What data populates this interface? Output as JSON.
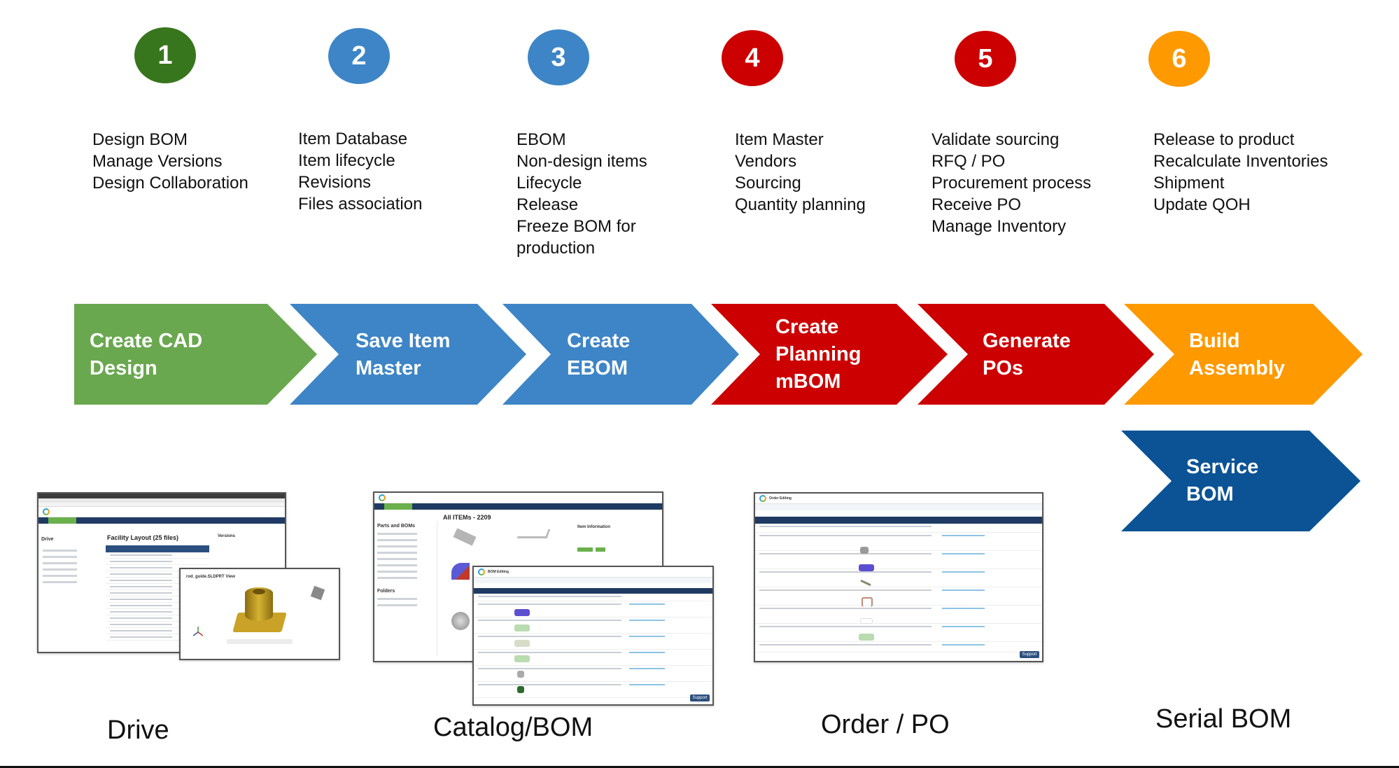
{
  "steps": [
    {
      "number": "1",
      "color": "#38761d",
      "bullets": [
        "Design BOM",
        "Manage Versions",
        "Design Collaboration"
      ]
    },
    {
      "number": "2",
      "color": "#3d85c6",
      "bullets": [
        "Item Database",
        "Item lifecycle",
        "Revisions",
        "Files association"
      ]
    },
    {
      "number": "3",
      "color": "#3d85c6",
      "bullets": [
        "EBOM",
        "Non-design items",
        "Lifecycle",
        "Release",
        "Freeze BOM for",
        "production"
      ]
    },
    {
      "number": "4",
      "color": "#cc0000",
      "bullets": [
        "Item Master",
        "Vendors",
        "Sourcing",
        "Quantity planning"
      ]
    },
    {
      "number": "5",
      "color": "#cc0000",
      "bullets": [
        "Validate sourcing",
        "RFQ / PO",
        "Procurement process",
        "Receive PO",
        "Manage Inventory"
      ]
    },
    {
      "number": "6",
      "color": "#ff9900",
      "bullets": [
        "Release to product",
        "Recalculate Inventories",
        "Shipment",
        "Update QOH"
      ]
    }
  ],
  "arrows": [
    {
      "lines": [
        "Create CAD",
        "Design"
      ],
      "color": "#6aa84f"
    },
    {
      "lines": [
        "Save Item",
        "Master"
      ],
      "color": "#3d85c6"
    },
    {
      "lines": [
        "Create",
        "EBOM"
      ],
      "color": "#3d85c6"
    },
    {
      "lines": [
        "Create",
        "Planning",
        "mBOM"
      ],
      "color": "#cc0000"
    },
    {
      "lines": [
        "Generate",
        "POs"
      ],
      "color": "#cc0000"
    },
    {
      "lines": [
        "Build",
        "Assembly"
      ],
      "color": "#ff9900"
    },
    {
      "lines": [
        "Service",
        "BOM"
      ],
      "color": "#0b5394"
    }
  ],
  "screenshots": {
    "drive": {
      "title": "Facility Layout (25 files)",
      "sidebar_title": "Drive",
      "panel_title": "Versions",
      "viewer_title": "rod_guide.SLDPRT View"
    },
    "catalog": {
      "title": "All ITEMs - 2209",
      "sidebar_title": "Parts and BOMs",
      "folders_title": "Folders",
      "panel_title": "Item Information"
    },
    "bom_editing": {
      "title": "BOM Editing",
      "support_label": "Support"
    },
    "order": {
      "title": "Order Editing",
      "support_label": "Support"
    }
  },
  "bottom_labels": {
    "drive": "Drive",
    "catalog": "Catalog/BOM",
    "order": "Order / PO",
    "serial": "Serial BOM"
  }
}
